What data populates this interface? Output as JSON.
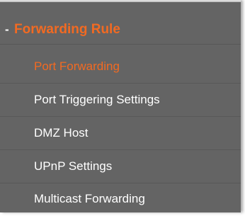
{
  "theme": {
    "panel_bg": "#646464",
    "accent": "#f26a22",
    "text": "#ffffff"
  },
  "section": {
    "collapse_sign": "-",
    "title": "Forwarding Rule",
    "expanded": true
  },
  "menu": {
    "items": [
      {
        "label": "Port Forwarding",
        "active": true
      },
      {
        "label": "Port Triggering Settings",
        "active": false
      },
      {
        "label": "DMZ Host",
        "active": false
      },
      {
        "label": "UPnP Settings",
        "active": false
      },
      {
        "label": "Multicast Forwarding",
        "active": false
      }
    ]
  }
}
